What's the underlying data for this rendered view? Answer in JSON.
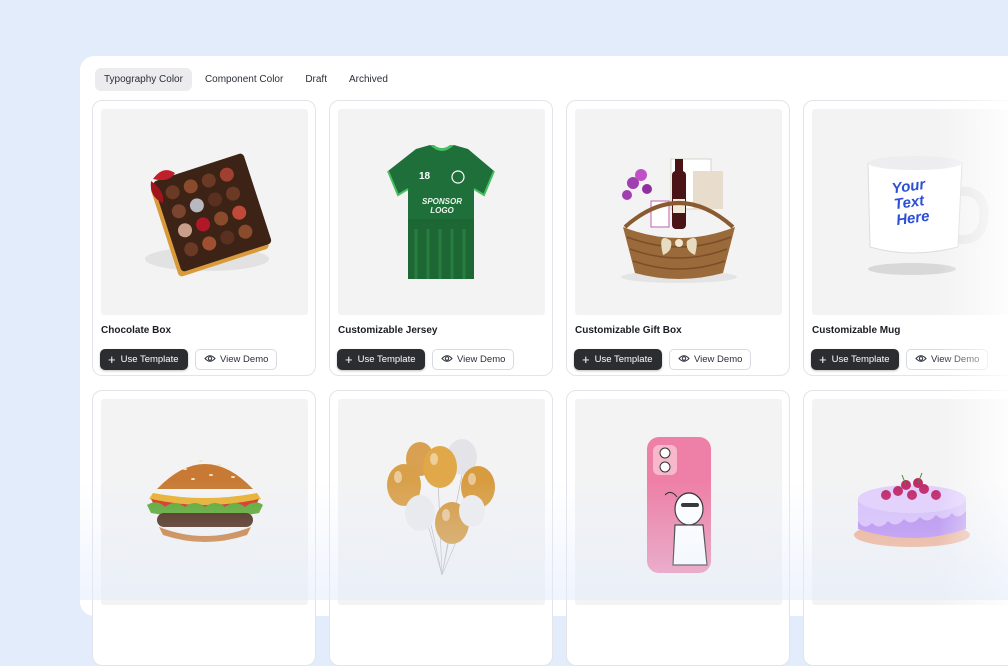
{
  "tabs": [
    {
      "label": "Typography Color",
      "active": true
    },
    {
      "label": "Component Color",
      "active": false
    },
    {
      "label": "Draft",
      "active": false
    },
    {
      "label": "Archived",
      "active": false
    }
  ],
  "actions": {
    "use_template": "Use Template",
    "view_demo": "View Demo",
    "use_icon": "plus-icon",
    "demo_icon": "eye-icon"
  },
  "products": [
    {
      "title": "Chocolate Box",
      "image": "chocolate-box-image"
    },
    {
      "title": "Customizable Jersey",
      "image": "jersey-image"
    },
    {
      "title": "Customizable Gift Box",
      "image": "gift-basket-image"
    },
    {
      "title": "Customizable Mug",
      "image": "mug-image"
    },
    {
      "title": "",
      "image": "burger-image"
    },
    {
      "title": "",
      "image": "balloons-image"
    },
    {
      "title": "",
      "image": "phone-case-image"
    },
    {
      "title": "",
      "image": "cake-image"
    }
  ],
  "image_text": {
    "jersey_number": "18",
    "jersey_sponsor_line1": "SPONSOR",
    "jersey_sponsor_line2": "LOGO",
    "mug_line1": "Your",
    "mug_line2": "Text",
    "mug_line3": "Here"
  },
  "colors": {
    "page_bg": "#e3ecfb",
    "primary_button": "#2b2d31",
    "active_tab": "#ececef"
  }
}
